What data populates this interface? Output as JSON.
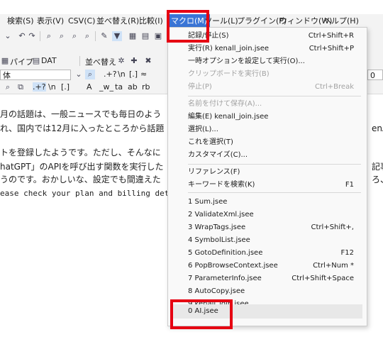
{
  "menubar": {
    "items": [
      "検索(S)",
      "表示(V)",
      "CSV(C)",
      "並べ替え(R)",
      "比較(I)",
      "マクロ(M)",
      "ツール(L)",
      "プラグイン(P)",
      "ウィンドウ(W)",
      "ヘルプ(H)"
    ]
  },
  "toolbar": {
    "pipe_label": "パイプ",
    "dat_label": "DAT",
    "sort_label": "並べ替え",
    "font_combo": "体",
    "size_combo": "0",
    "regex_tokens": [
      ".+?",
      "\\n",
      "[.]",
      "≈"
    ],
    "find_tokens": [
      ".+?",
      "\\n",
      "[.]",
      "A",
      "_w_",
      "ta",
      "ab",
      "rb"
    ]
  },
  "editor": {
    "lines": [
      "月の話題は、一般ニュースでも毎日のよう",
      "れ、国内では12月に入ったところから話題",
      "トを登録したようです。ただし、そんなに",
      "hatGPT」のAPIを呼び出す関数を実行した",
      "うのです。おかしいな、設定でも間違えた",
      "ease check your plan and billing deta"
    ],
    "right_tails": [
      "enAP",
      "記事",
      "ろ、"
    ]
  },
  "macro_menu": {
    "items": [
      {
        "label": "記録/停止(S)",
        "shortcut": "Ctrl+Shift+R",
        "disabled": false
      },
      {
        "label": "実行(R)  kenall_join.jsee",
        "shortcut": "Ctrl+Shift+P",
        "disabled": false
      },
      {
        "label": "一時オプションを設定して実行(O)...",
        "shortcut": "",
        "disabled": false
      },
      {
        "label": "クリップボードを実行(B)",
        "shortcut": "",
        "disabled": true
      },
      {
        "label": "停止(P)",
        "shortcut": "Ctrl+Break",
        "disabled": true
      },
      {
        "label": "名前を付けて保存(A)...",
        "shortcut": "",
        "disabled": true
      },
      {
        "label": "編集(E)  kenall_join.jsee",
        "shortcut": "",
        "disabled": false
      },
      {
        "label": "選択(L)...",
        "shortcut": "",
        "disabled": false
      },
      {
        "label": "これを選択(T)",
        "shortcut": "",
        "disabled": false
      },
      {
        "label": "カスタマイズ(C)...",
        "shortcut": "",
        "disabled": false
      },
      {
        "label": "リファレンス(F)",
        "shortcut": "",
        "disabled": false
      },
      {
        "label": "キーワードを検索(K)",
        "shortcut": "F1",
        "disabled": false
      },
      {
        "label": "1 Sum.jsee",
        "shortcut": "",
        "disabled": false
      },
      {
        "label": "2 ValidateXml.jsee",
        "shortcut": "",
        "disabled": false
      },
      {
        "label": "3 WrapTags.jsee",
        "shortcut": "Ctrl+Shift+,",
        "disabled": false
      },
      {
        "label": "4 SymbolList.jsee",
        "shortcut": "",
        "disabled": false
      },
      {
        "label": "5 GotoDefinition.jsee",
        "shortcut": "F12",
        "disabled": false
      },
      {
        "label": "6 PopBrowseContext.jsee",
        "shortcut": "Ctrl+Num *",
        "disabled": false
      },
      {
        "label": "7 ParameterInfo.jsee",
        "shortcut": "Ctrl+Shift+Space",
        "disabled": false
      },
      {
        "label": "8 AutoCopy.jsee",
        "shortcut": "",
        "disabled": false
      },
      {
        "label": "9 kenall_join.jsee",
        "shortcut": "",
        "disabled": false
      },
      {
        "label": "0 AI.jsee",
        "shortcut": "",
        "disabled": false
      }
    ]
  },
  "colors": {
    "highlight": "#e60012",
    "menu_active": "#3a75d6",
    "disabled_text": "#a2a2a2"
  }
}
